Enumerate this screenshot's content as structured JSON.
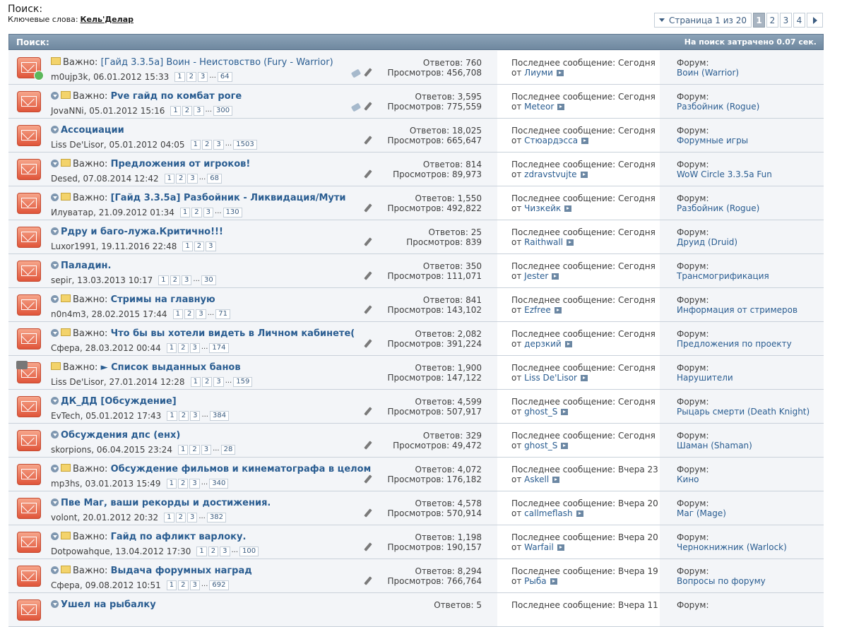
{
  "page": {
    "title": "Поиск:",
    "keywords_label": "Ключевые слова:",
    "keywords_value": "Кель'Делар"
  },
  "pagenav": {
    "label": "Страница 1 из 20",
    "pages": [
      "1",
      "2",
      "3",
      "4"
    ],
    "active": "1"
  },
  "header": {
    "left": "Поиск:",
    "right": "На поиск затрачено 0.07 сек."
  },
  "labels": {
    "important": "Важно:",
    "replies": "Ответов:",
    "views": "Просмотров:",
    "last_post": "Последнее сообщение:",
    "by": "от",
    "forum": "Форум:"
  },
  "threads": [
    {
      "important": true,
      "title": "[Гайд 3.3.5a] Воин - Неистовство (Fury - Warrior)",
      "bold": false,
      "author": "m0ujp3k",
      "date": "06.01.2012 15:33",
      "pages": [
        "1",
        "2",
        "3",
        "64"
      ],
      "replies": "760",
      "views": "456,708",
      "last_when": "Сегодня",
      "last_by": "Лиуми",
      "forum": "Воин (Warrior)",
      "tag": true,
      "arrow": false,
      "badge": true,
      "clip": false
    },
    {
      "important": true,
      "title": "Pve гайд по комбат роге",
      "bold": true,
      "author": "JovaNNi",
      "date": "05.01.2012 15:16",
      "pages": [
        "1",
        "2",
        "3",
        "300"
      ],
      "replies": "3,595",
      "views": "775,559",
      "last_when": "Сегодня",
      "last_by": "Meteor",
      "forum": "Разбойник (Rogue)",
      "tag": true,
      "arrow": true,
      "badge": false,
      "clip": false
    },
    {
      "important": false,
      "title": "Ассоциации",
      "bold": true,
      "author": "Liss De'Lisor",
      "date": "05.01.2012 04:05",
      "pages": [
        "1",
        "2",
        "3",
        "1503"
      ],
      "replies": "18,025",
      "views": "665,647",
      "last_when": "Сегодня",
      "last_by": "Стюардэсса",
      "forum": "Форумные игры",
      "tag": false,
      "arrow": true,
      "badge": false,
      "clip": false
    },
    {
      "important": true,
      "title": "Предложения от игроков!",
      "bold": true,
      "author": "Desed",
      "date": "07.08.2014 12:42",
      "pages": [
        "1",
        "2",
        "3",
        "68"
      ],
      "replies": "814",
      "views": "89,973",
      "last_when": "Сегодня",
      "last_by": "zdravstvujte",
      "forum": "WoW Circle 3.3.5a Fun",
      "tag": false,
      "arrow": true,
      "badge": false,
      "clip": false
    },
    {
      "important": true,
      "title": "[Гайд 3.3.5a] Разбойник - Ликвидация/Мути",
      "bold": true,
      "author": "Илуватар",
      "date": "21.09.2012 01:34",
      "pages": [
        "1",
        "2",
        "3",
        "130"
      ],
      "replies": "1,550",
      "views": "492,822",
      "last_when": "Сегодня",
      "last_by": "Чизкейк",
      "forum": "Разбойник (Rogue)",
      "tag": false,
      "arrow": true,
      "badge": false,
      "clip": false
    },
    {
      "important": false,
      "title": "Рдру и баго-лужа.Критично!!!",
      "bold": true,
      "author": "Luxor1991",
      "date": "19.11.2016 22:48",
      "pages": [
        "1",
        "2",
        "3"
      ],
      "replies": "25",
      "views": "839",
      "last_when": "Сегодня",
      "last_by": "Raithwall",
      "forum": "Друид (Druid)",
      "tag": false,
      "arrow": true,
      "badge": false,
      "clip": false
    },
    {
      "important": false,
      "title": "Паладин.",
      "bold": true,
      "author": "sepir",
      "date": "13.03.2013 10:17",
      "pages": [
        "1",
        "2",
        "3",
        "30"
      ],
      "replies": "350",
      "views": "111,071",
      "last_when": "Сегодня",
      "last_by": "Jester",
      "forum": "Трансмогрификация",
      "tag": false,
      "arrow": true,
      "badge": false,
      "clip": false
    },
    {
      "important": true,
      "title": "Стримы на главную",
      "bold": true,
      "author": "n0n4m3",
      "date": "28.02.2015 17:44",
      "pages": [
        "1",
        "2",
        "3",
        "71"
      ],
      "replies": "841",
      "views": "143,102",
      "last_when": "Сегодня",
      "last_by": "Ezfree",
      "forum": "Информация от стримеров",
      "tag": false,
      "arrow": true,
      "badge": false,
      "clip": false
    },
    {
      "important": true,
      "title": "Что бы вы хотели видеть в Личном кабинете(",
      "bold": true,
      "author": "Сфера",
      "date": "28.03.2012 00:44",
      "pages": [
        "1",
        "2",
        "3",
        "174"
      ],
      "replies": "2,082",
      "views": "391,224",
      "last_when": "Сегодня",
      "last_by": "дерзкий",
      "forum": "Предложения по проекту",
      "tag": false,
      "arrow": true,
      "badge": false,
      "clip": false
    },
    {
      "important": true,
      "title": "► Список выданных банов",
      "bold": true,
      "author": "Liss De'Lisor",
      "date": "27.01.2014 12:28",
      "pages": [
        "1",
        "2",
        "3",
        "159"
      ],
      "replies": "1,900",
      "views": "147,122",
      "last_when": "Сегодня",
      "last_by": "Liss De'Lisor",
      "forum": "Нарушители",
      "tag": false,
      "arrow": false,
      "badge": false,
      "clip": true,
      "no_pen": true
    },
    {
      "important": false,
      "title": "ДК_ДД [Обсуждение]",
      "bold": true,
      "author": "EvTech",
      "date": "05.01.2012 17:43",
      "pages": [
        "1",
        "2",
        "3",
        "384"
      ],
      "replies": "4,599",
      "views": "507,917",
      "last_when": "Сегодня",
      "last_by": "ghost_S",
      "forum": "Рыцарь смерти (Death Knight)",
      "tag": false,
      "arrow": true,
      "badge": false,
      "clip": false
    },
    {
      "important": false,
      "title": "Обсуждения дпс (енх)",
      "bold": true,
      "author": "skorpions",
      "date": "06.04.2015 23:24",
      "pages": [
        "1",
        "2",
        "3",
        "28"
      ],
      "replies": "329",
      "views": "49,472",
      "last_when": "Сегодня",
      "last_by": "ghost_S",
      "forum": "Шаман (Shaman)",
      "tag": false,
      "arrow": true,
      "badge": false,
      "clip": false
    },
    {
      "important": true,
      "title": "Обсуждение фильмов и кинематографа в целом",
      "bold": true,
      "author": "mp3hs",
      "date": "03.01.2013 15:49",
      "pages": [
        "1",
        "2",
        "3",
        "340"
      ],
      "replies": "4,072",
      "views": "176,182",
      "last_when": "Вчера 23",
      "last_by": "Askell",
      "forum": "Кино",
      "tag": false,
      "arrow": true,
      "badge": false,
      "clip": false
    },
    {
      "important": false,
      "title": "Пве Маг, ваши рекорды и достижения.",
      "bold": true,
      "author": "volont",
      "date": "20.01.2012 20:32",
      "pages": [
        "1",
        "2",
        "3",
        "382"
      ],
      "replies": "4,578",
      "views": "570,914",
      "last_when": "Вчера 20",
      "last_by": "callmeflash",
      "forum": "Маг (Mage)",
      "tag": false,
      "arrow": true,
      "badge": false,
      "clip": false
    },
    {
      "important": true,
      "title": "Гайд по афликт варлоку.",
      "bold": true,
      "author": "Dotpowahque",
      "date": "13.04.2012 17:30",
      "pages": [
        "1",
        "2",
        "3",
        "100"
      ],
      "replies": "1,198",
      "views": "190,157",
      "last_when": "Вчера 20",
      "last_by": "Warfail",
      "forum": "Чернокнижник (Warlock)",
      "tag": false,
      "arrow": true,
      "badge": false,
      "clip": false
    },
    {
      "important": true,
      "title": "Выдача форумных наград",
      "bold": true,
      "author": "Сфера",
      "date": "09.08.2012 10:51",
      "pages": [
        "1",
        "2",
        "3",
        "692"
      ],
      "replies": "8,294",
      "views": "766,764",
      "last_when": "Вчера 19",
      "last_by": "Рыба",
      "forum": "Вопросы по форуму",
      "tag": false,
      "arrow": true,
      "badge": false,
      "clip": false
    },
    {
      "important": false,
      "title": "Ушел на рыбалку",
      "bold": true,
      "author": "",
      "date": "",
      "pages": [],
      "replies": "5",
      "views": "",
      "last_when": "Вчера 11",
      "last_by": "",
      "forum": "",
      "tag": false,
      "arrow": true,
      "badge": false,
      "clip": false
    }
  ]
}
